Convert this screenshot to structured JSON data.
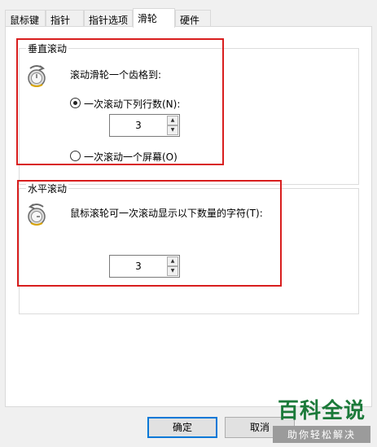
{
  "tabs": [
    {
      "label": "鼠标键",
      "active": false
    },
    {
      "label": "指针",
      "active": false
    },
    {
      "label": "指针选项",
      "active": false
    },
    {
      "label": "滑轮",
      "active": true
    },
    {
      "label": "硬件",
      "active": false
    }
  ],
  "vertical": {
    "title": "垂直滚动",
    "prompt": "滚动滑轮一个齿格到:",
    "option_lines": "一次滚动下列行数(N):",
    "lines_value": "3",
    "option_screen": "一次滚动一个屏幕(O)",
    "selected": "lines"
  },
  "horizontal": {
    "title": "水平滚动",
    "prompt": "鼠标滚轮可一次滚动显示以下数量的字符(T):",
    "chars_value": "3"
  },
  "buttons": {
    "ok": "确定",
    "cancel": "取消"
  },
  "watermark": {
    "main": "百科全说",
    "sub": "助你轻松解决"
  },
  "colors": {
    "highlight": "#d81e1e",
    "default_button": "#0078d7"
  }
}
